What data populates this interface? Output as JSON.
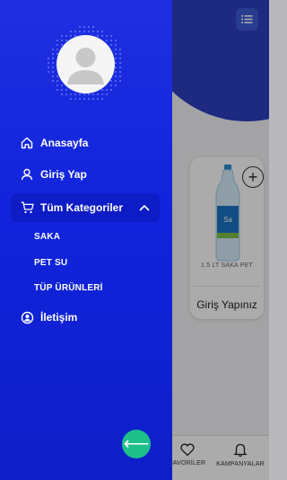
{
  "drawer": {
    "menu": {
      "home": "Anasayfa",
      "login": "Giriş Yap",
      "categories": "Tüm Kategoriler",
      "contact": "İletişim"
    },
    "subcategories": [
      "SAKA",
      "PET SU",
      "TÜP ÜRÜNLERİ"
    ]
  },
  "background": {
    "product_name": "1.5 LT SAKA PET",
    "login_prompt": "Giriş Yapınız",
    "plus_symbol": "+",
    "bottom_nav": {
      "favorites": "FAVORİLER",
      "campaigns": "KAMPANYALAR"
    }
  },
  "icons": {
    "home": "home-icon",
    "user": "user-icon",
    "cart": "cart-icon",
    "chevron": "chevron-up-icon",
    "contact": "contact-icon",
    "back": "arrow-left-icon",
    "heart": "heart-icon",
    "bell": "bell-icon",
    "menu": "list-icon"
  },
  "colors": {
    "drawer_gradient_top": "#1f2fe0",
    "drawer_gradient_bottom": "#0f1fc8",
    "back_button": "#1ec08a"
  },
  "back_arrow": "⟵"
}
